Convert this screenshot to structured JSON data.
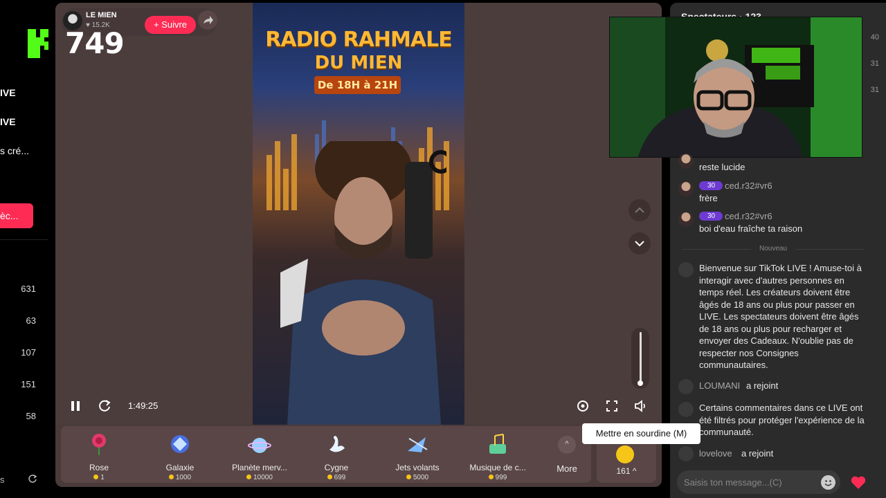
{
  "sidebar": {
    "items": [
      {
        "label": "IVE"
      },
      {
        "label": "IVE"
      },
      {
        "label": "s cré..."
      }
    ],
    "button_label": "èc...",
    "counts": [
      "631",
      "63",
      "107",
      "151",
      "58"
    ],
    "footer_label": "s"
  },
  "kick": {
    "viewer_count": "749"
  },
  "channel": {
    "name": "LE MIEN",
    "likes": "15.2K",
    "follow_label": "+ Suivre"
  },
  "video": {
    "title_line1": "RADIO RAHMALE",
    "title_line2": "DU MIEN",
    "schedule": "De 18H à 21H"
  },
  "player": {
    "elapsed": "1:49:25",
    "volume_level": 0.0,
    "mute_tooltip": "Mettre en sourdine (M)"
  },
  "gifts": [
    {
      "name": "Rose",
      "price": "1",
      "icon": "rose-icon"
    },
    {
      "name": "Galaxie",
      "price": "1000",
      "icon": "galaxy-icon"
    },
    {
      "name": "Planète merv...",
      "price": "10000",
      "icon": "planet-icon"
    },
    {
      "name": "Cygne",
      "price": "699",
      "icon": "swan-icon"
    },
    {
      "name": "Jets volants",
      "price": "5000",
      "icon": "jets-icon"
    },
    {
      "name": "Musique de c...",
      "price": "999",
      "icon": "music-icon"
    }
  ],
  "gift_more_label": "More",
  "coins": {
    "balance": "161"
  },
  "chat": {
    "header": "Spectateurs · 123",
    "side_numbers": [
      "40",
      "31",
      "31"
    ],
    "messages": [
      {
        "text": "reste lucide"
      },
      {
        "badge": "30",
        "user": "ced.r32#vr6",
        "text": "frère"
      },
      {
        "badge": "30",
        "user": "ced.r32#vr6",
        "text": "boi d'eau fraîche ta raison"
      }
    ],
    "new_divider": "Nouveau",
    "system_welcome": "Bienvenue sur TikTok LIVE ! Amuse-toi à interagir avec d'autres personnes en temps réel. Les créateurs doivent être âgés de 18 ans ou plus pour passer en LIVE. Les spectateurs doivent être âgés de 18 ans ou plus pour recharger et envoyer des Cadeaux. N'oublie pas de respecter nos Consignes communautaires.",
    "join1": {
      "user": "LOUMANI",
      "action": "a rejoint"
    },
    "system_filtered": "Certains commentaires dans ce LIVE ont été filtrés pour protéger l'expérience de la communauté.",
    "join2": {
      "user": "lovelove",
      "action": "a rejoint"
    },
    "input_placeholder": "Saisis ton message...(C)"
  },
  "colors": {
    "accent": "#fe2c55",
    "panel": "#4a3a3a",
    "chat_bg": "#2b2b2b",
    "kick_green": "#53fc18",
    "badge_purple": "#6d3bd1"
  }
}
